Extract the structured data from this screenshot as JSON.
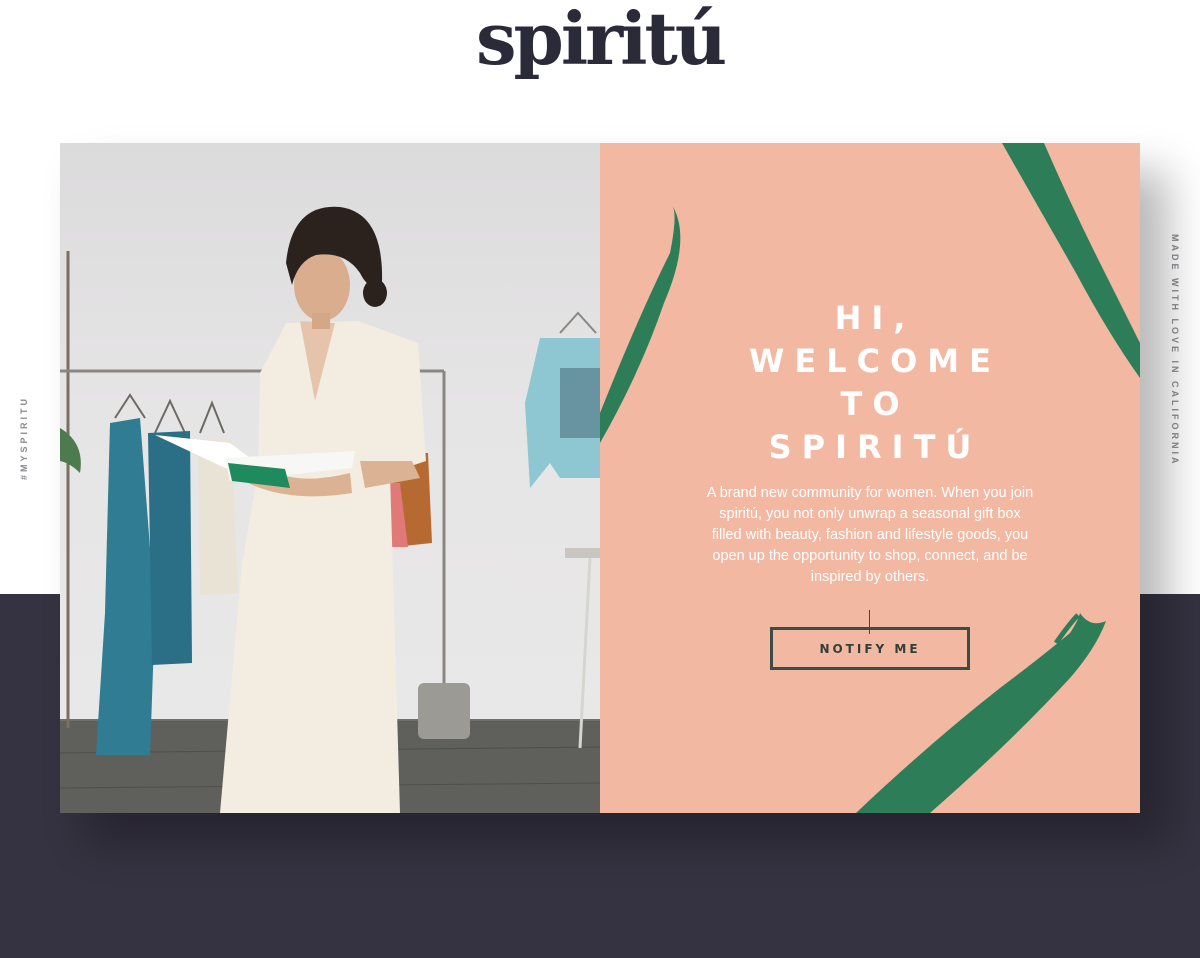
{
  "brand": {
    "logo_text": "spiritú"
  },
  "side": {
    "left_label": "#MYSPIRITU",
    "right_label": "MADE WITH LOVE IN CALIFORNIA"
  },
  "hero": {
    "headline": [
      "HI,",
      "WELCOME",
      "TO",
      "SPIRITÚ"
    ],
    "intro": "A brand new community for women. When you join spiritú, you not only unwrap a seasonal gift box filled with beauty, fashion and lifestyle goods, you open up the opportunity to shop, connect, and be inspired by others.",
    "cta_label": "NOTIFY ME"
  },
  "colors": {
    "panel_bg": "#f2b8a2",
    "leaf": "#2e7d59",
    "dark_band": "#353241",
    "logo": "#2b2a38"
  }
}
